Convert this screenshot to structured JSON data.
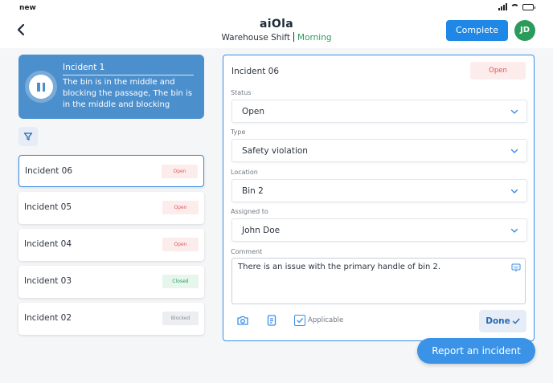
{
  "status_bar": {
    "time": "new"
  },
  "header": {
    "logo": "aiOla",
    "subtitle_location": "Warehouse Shift",
    "subtitle_shift": "Morning",
    "complete_label": "Complete",
    "avatar_initials": "JD"
  },
  "active_incident": {
    "title": "Incident 1",
    "description": "The bin is in the middle and blocking the passage, The bin is in the middle and blocking"
  },
  "incident_list": [
    {
      "label": "Incident 06",
      "status": "Open"
    },
    {
      "label": "Incident 05",
      "status": "Open"
    },
    {
      "label": "Incident 04",
      "status": "Open"
    },
    {
      "label": "Incident 03",
      "status": "Closed"
    },
    {
      "label": "Incident 02",
      "status": "Blocked"
    }
  ],
  "detail": {
    "title": "Incident 06",
    "status_badge": "Open",
    "status_label": "Status",
    "status_value": "Open",
    "type_label": "Type",
    "type_value": "Safety violation",
    "location_label": "Location",
    "location_value": "Bin 2",
    "assigned_label": "Assigned to",
    "assigned_value": "John Doe",
    "comment_label": "Comment",
    "comment_value": "There is an issue with the primary handle of bin 2.",
    "applicable_label": "Applicable",
    "done_label": "Done"
  },
  "report_label": "Report an incident",
  "colors": {
    "accent": "#1f87e5",
    "brand_green": "#2b9b5b",
    "card_blue": "#4c8fcd",
    "open_red": "#e25656"
  }
}
